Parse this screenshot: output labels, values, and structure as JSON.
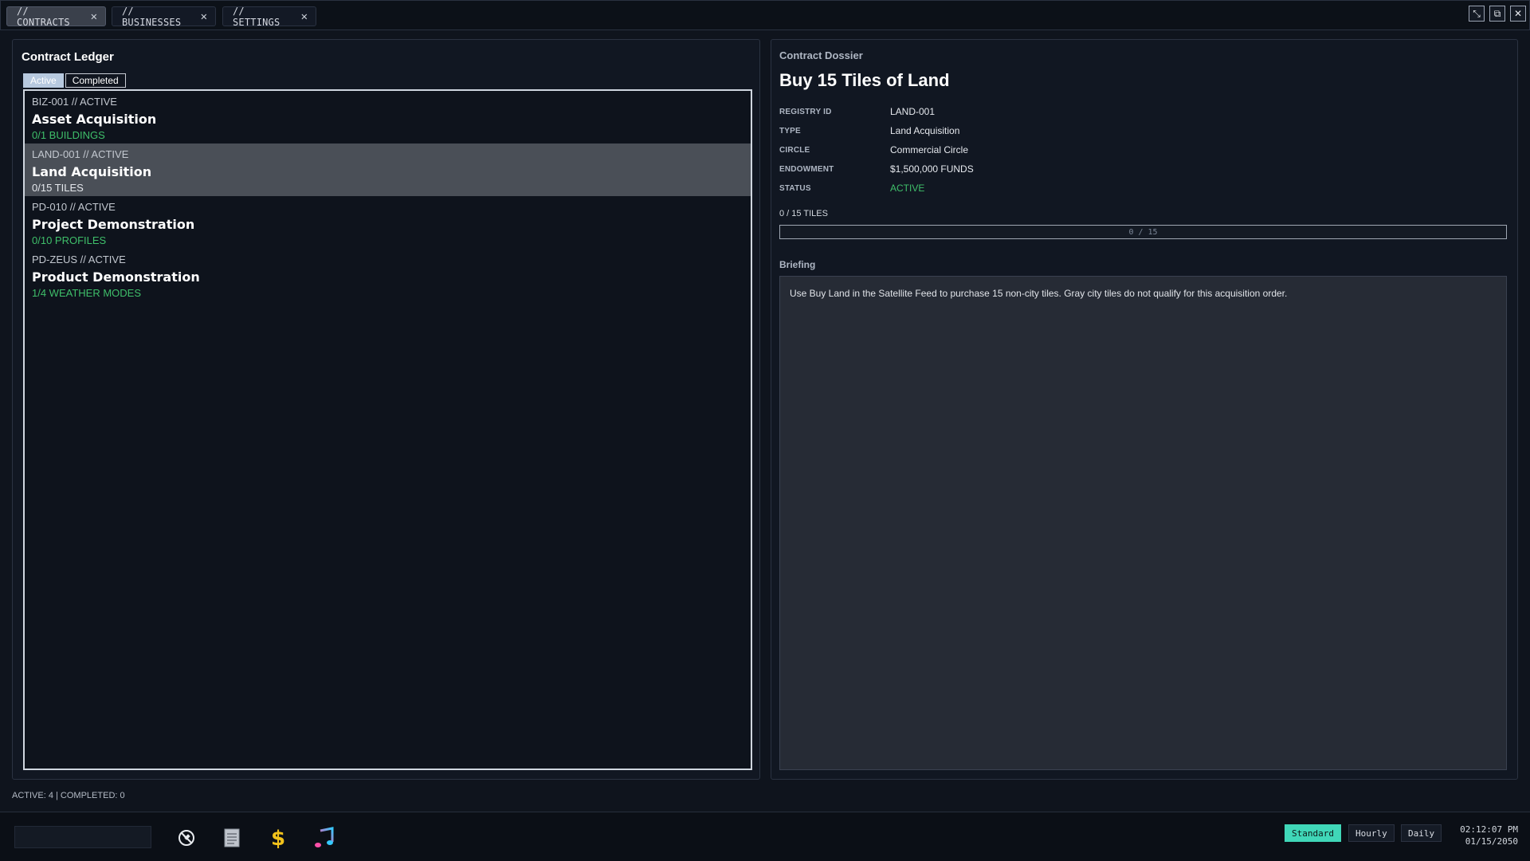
{
  "window_tabs": [
    {
      "label": "// CONTRACTS",
      "active": true
    },
    {
      "label": "// BUSINESSES",
      "active": false
    },
    {
      "label": "// SETTINGS",
      "active": false
    }
  ],
  "window_controls": {
    "minimize": "⤡",
    "popout": "⧉",
    "close": "✕"
  },
  "ledger": {
    "title": "Contract Ledger",
    "tabs": [
      {
        "label": "Active",
        "active": true
      },
      {
        "label": "Completed",
        "active": false
      }
    ],
    "entries": [
      {
        "id": "BIZ-001 // ACTIVE",
        "title": "Asset Acquisition",
        "progress": "0/1 BUILDINGS",
        "progress_color": "green",
        "selected": false
      },
      {
        "id": "LAND-001 // ACTIVE",
        "title": "Land Acquisition",
        "progress": "0/15 TILES",
        "progress_color": "light",
        "selected": true
      },
      {
        "id": "PD-010 // ACTIVE",
        "title": "Project Demonstration",
        "progress": "0/10 PROFILES",
        "progress_color": "green",
        "selected": false
      },
      {
        "id": "PD-ZEUS // ACTIVE",
        "title": "Product Demonstration",
        "progress": "1/4 WEATHER MODES",
        "progress_color": "green",
        "selected": false
      }
    ]
  },
  "dossier": {
    "section_title": "Contract Dossier",
    "title": "Buy 15 Tiles of Land",
    "fields": [
      {
        "label": "REGISTRY ID",
        "value": "LAND-001"
      },
      {
        "label": "TYPE",
        "value": "Land Acquisition"
      },
      {
        "label": "CIRCLE",
        "value": "Commercial Circle"
      },
      {
        "label": "ENDOWMENT",
        "value": "$1,500,000 FUNDS"
      },
      {
        "label": "STATUS",
        "value": "ACTIVE"
      }
    ],
    "progress_label": "0 / 15 TILES",
    "progress_bar_text": "0 / 15",
    "progress_fraction": 0,
    "briefing_title": "Briefing",
    "briefing_text": "Use Buy Land in the Satellite Feed to purchase 15 non-city tiles. Gray city tiles do not qualify for this acquisition order."
  },
  "status_line": "ACTIVE: 4 | COMPLETED: 0",
  "taskbar": {
    "search_value": "",
    "icons": [
      "satellite-off-icon",
      "notepad-icon",
      "dollar-icon",
      "music-note-icon"
    ],
    "speed_buttons": [
      {
        "label": "Standard",
        "active": true
      },
      {
        "label": "Hourly",
        "active": false
      },
      {
        "label": "Daily",
        "active": false
      }
    ],
    "time": "02:12:07 PM",
    "date": "01/15/2050"
  },
  "colors": {
    "accent_teal": "#40d7b8",
    "status_green": "#3fbf6a",
    "selected_row": "#4a4f57",
    "dollar_yellow": "#f2c21b",
    "music_gradient_start": "#ff4fa8",
    "music_gradient_end": "#35c9ff"
  }
}
